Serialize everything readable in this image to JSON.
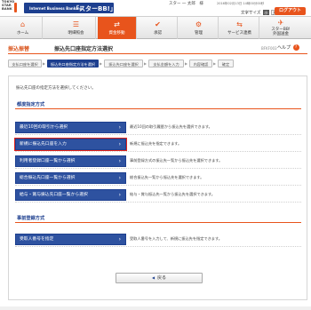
{
  "header": {
    "logo_lines": [
      "TOKYO",
      "STAR",
      "BANK"
    ],
    "service_name": "Internet Business Banking",
    "app_name": "「スターBB!」",
    "user_info": "スター 一 太郎　様",
    "last_login": "2016年02月13日 14時00分00秒",
    "font_size_label": "文字サイズ",
    "font_sizes": [
      "小",
      "大"
    ],
    "logout_label": "ログアウト"
  },
  "nav": {
    "items": [
      {
        "label": "ホーム",
        "icon": "home-icon",
        "glyph": "⌂"
      },
      {
        "label": "明細照会",
        "icon": "statement-icon",
        "glyph": "☰"
      },
      {
        "label": "資金移動",
        "icon": "fund-transfer-icon",
        "glyph": "⇄"
      },
      {
        "label": "承認",
        "icon": "approval-icon",
        "glyph": "✔"
      },
      {
        "label": "管理",
        "icon": "management-icon",
        "glyph": "⚙"
      },
      {
        "label": "サービス連携",
        "icon": "service-link-icon",
        "glyph": "⇆"
      },
      {
        "label": "スターBB!\n外国送金",
        "icon": "foreign-remittance-icon",
        "glyph": "✈"
      }
    ],
    "active_index": 2
  },
  "title": {
    "category": "振込振替",
    "main": "振込先口座指定方法選択",
    "screen_id": "BFKF003",
    "help_label": "ヘルプ",
    "help_glyph": "?"
  },
  "steps": [
    "支払口座を選択",
    "振込先口座指定方法を選択",
    "振込先口座を選択",
    "支払金額を入力",
    "内容確認",
    "確定"
  ],
  "active_step": 1,
  "intro_text": "振込先口座の指定方法を選択してください。",
  "sections": [
    {
      "heading": "都度指定方式",
      "options": [
        {
          "label": "最近10回の取引から選択",
          "desc": "最近10回の取引履歴から振込先を選択できます。"
        },
        {
          "label": "新規に振込先口座を入力",
          "desc": "新規に振込先を指定できます。"
        },
        {
          "label": "利用者登録口座一覧から選択",
          "desc": "事前登録方式の振込先一覧から振込先を選択できます。"
        },
        {
          "label": "総合振込先口座一覧から選択",
          "desc": "総合振込先一覧から振込先を選択できます。"
        },
        {
          "label": "給与・賞与振込先口座一覧から選択",
          "desc": "給与・賞与振込先一覧から振込先を選択できます。"
        }
      ]
    },
    {
      "heading": "事前登録方式",
      "options": [
        {
          "label": "受取人番号を指定",
          "desc": "受取人番号を入力して、新規に振込先を指定できます。"
        }
      ]
    }
  ],
  "highlighted_option": "新規に振込先口座を入力",
  "back_label": "戻る",
  "colors": {
    "accent": "#e8541c",
    "navy": "#1d3f8f",
    "button": "#2e52a0",
    "highlight_frame": "#e2231a"
  }
}
